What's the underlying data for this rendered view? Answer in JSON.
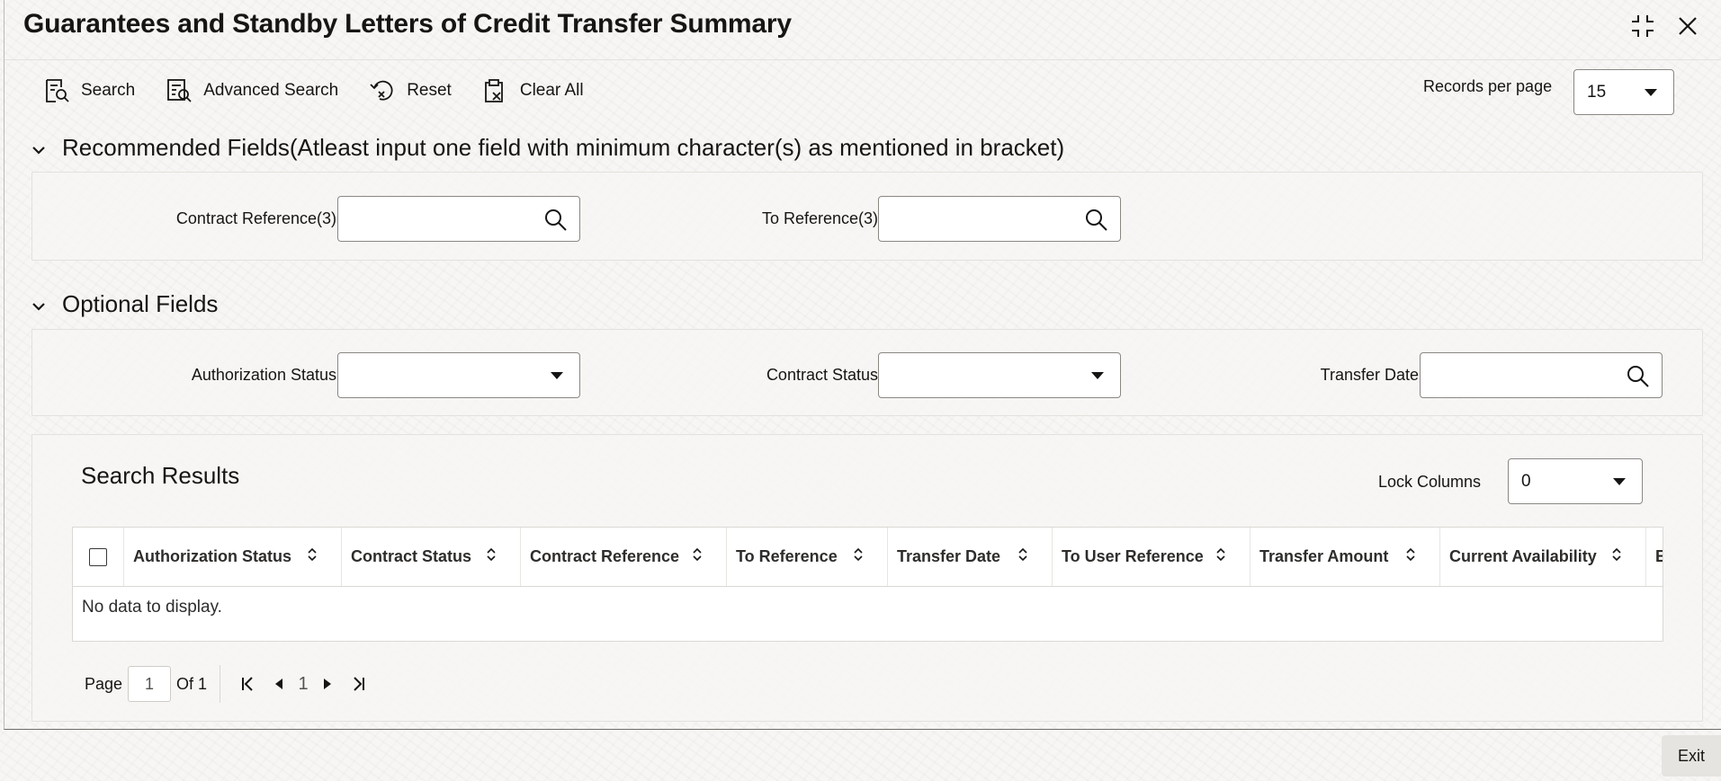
{
  "window": {
    "title": "Guarantees and Standby Letters of Credit Transfer Summary"
  },
  "toolbar": {
    "search": "Search",
    "advanced_search": "Advanced Search",
    "reset": "Reset",
    "clear_all": "Clear All",
    "records_per_page_label": "Records per page",
    "records_per_page_value": "15"
  },
  "recommended": {
    "heading": "Recommended Fields(Atleast input one field with minimum character(s) as mentioned in bracket)",
    "contract_reference_label": "Contract Reference(3)",
    "contract_reference_value": "",
    "to_reference_label": "To Reference(3)",
    "to_reference_value": ""
  },
  "optional": {
    "heading": "Optional Fields",
    "authorization_status_label": "Authorization Status",
    "authorization_status_value": "",
    "contract_status_label": "Contract Status",
    "contract_status_value": "",
    "transfer_date_label": "Transfer Date",
    "transfer_date_value": ""
  },
  "results": {
    "title": "Search Results",
    "lock_columns_label": "Lock Columns",
    "lock_columns_value": "0",
    "columns": [
      "Authorization Status",
      "Contract Status",
      "Contract Reference",
      "To Reference",
      "Transfer Date",
      "To User Reference",
      "Transfer Amount",
      "Current Availability",
      "E"
    ],
    "empty_message": "No data to display.",
    "pager": {
      "page_label": "Page",
      "page_value": "1",
      "of_label": "Of 1",
      "current": "1"
    }
  },
  "footer": {
    "exit": "Exit"
  },
  "icons": {
    "collapse": "collapse-icon",
    "close": "close-icon",
    "search": "search-icon",
    "advanced_search": "advanced-search-icon",
    "reset": "reset-icon",
    "clear_all": "clear-all-icon",
    "chevron": "chevron-down-icon",
    "sort": "sort-icon"
  }
}
